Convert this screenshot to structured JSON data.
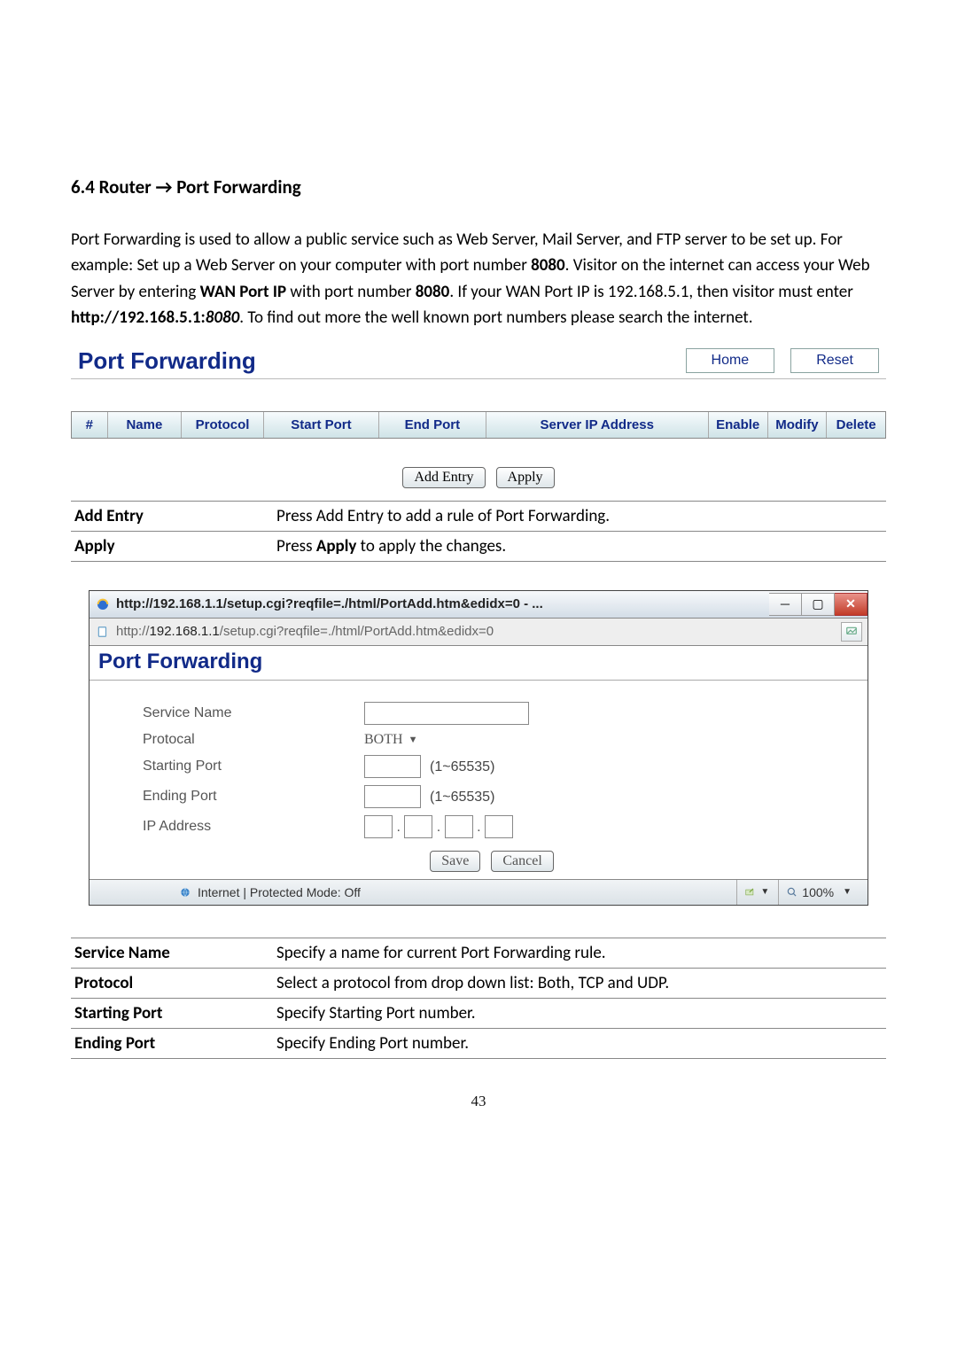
{
  "heading": "6.4 Router → Port Forwarding",
  "paragraph": {
    "p1": "Port Forwarding is used to allow a public service such as Web Server, Mail Server, and FTP server to be set up. For example: Set up a Web Server on your computer with port number ",
    "b1": "8080",
    "p2": ". Visitor on the internet can access your Web Server by entering ",
    "b2": "WAN Port IP",
    "p3": " with port number ",
    "b3": "8080",
    "p4": ". If your WAN Port IP is 192.168.5.1, then visitor must enter ",
    "b4": "http://192.168.5.1:",
    "bi": "8080",
    "p5": ". To find out more the well known port numbers please search the internet."
  },
  "shot1": {
    "title": "Port Forwarding",
    "home": "Home",
    "reset": "Reset",
    "cols": {
      "idx": "#",
      "name": "Name",
      "proto": "Protocol",
      "sport": "Start Port",
      "eport": "End Port",
      "ip": "Server IP Address",
      "enable": "Enable",
      "modify": "Modify",
      "delete": "Delete"
    },
    "add_entry": "Add Entry",
    "apply": "Apply"
  },
  "desc1": {
    "r1l": "Add Entry",
    "r1d": "Press Add Entry to add a rule of Port Forwarding.",
    "r2l": "Apply",
    "r2d_a": "Press ",
    "r2d_b": "Apply",
    "r2d_c": " to apply the changes."
  },
  "popup": {
    "title_full": "http://192.168.1.1/setup.cgi?reqfile=./html/PortAdd.htm&edidx=0 - ...",
    "addr_pre": "http://",
    "addr_bold": "192.168.1.1",
    "addr_post": "/setup.cgi?reqfile=./html/PortAdd.htm&edidx=0",
    "pf_title": "Port Forwarding",
    "labels": {
      "service": "Service Name",
      "protocal": "Protocal",
      "start": "Starting Port",
      "end": "Ending Port",
      "ip": "IP Address"
    },
    "protocal_value": "BOTH",
    "range": "(1~65535)",
    "save": "Save",
    "cancel": "Cancel",
    "status_left": "Internet | Protected Mode: Off",
    "zoom": "100%"
  },
  "desc2": {
    "r1l": "Service Name",
    "r1d": "Specify a name for current Port Forwarding rule.",
    "r2l": "Protocol",
    "r2d": "Select a protocol from drop down list: Both, TCP and UDP.",
    "r3l": "Starting Port",
    "r3d": "Specify Starting Port number.",
    "r4l": "Ending Port",
    "r4d": "Specify Ending Port number."
  },
  "page_number": "43"
}
